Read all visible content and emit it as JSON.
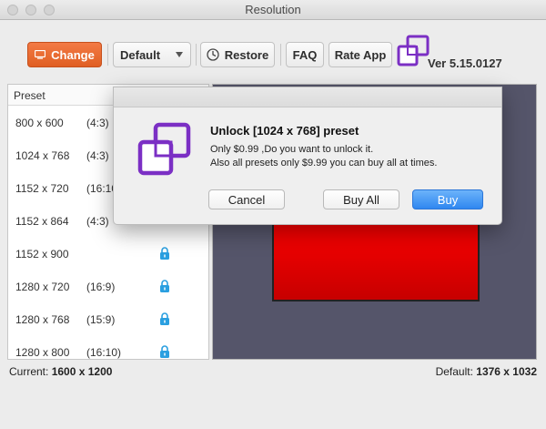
{
  "window": {
    "title": "Resolution"
  },
  "toolbar": {
    "change_label": "Change",
    "default_label": "Default",
    "restore_label": "Restore",
    "faq_label": "FAQ",
    "rate_label": "Rate App",
    "version": "Ver 5.15.0127"
  },
  "list": {
    "header": "Preset",
    "items": [
      {
        "res": "800 x 600",
        "ratio": "(4:3)",
        "locked": false
      },
      {
        "res": "1024 x 768",
        "ratio": "(4:3)",
        "locked": false
      },
      {
        "res": "1152 x 720",
        "ratio": "(16:10)",
        "locked": false
      },
      {
        "res": "1152 x 864",
        "ratio": "(4:3)",
        "locked": false
      },
      {
        "res": "1152 x 900",
        "ratio": "",
        "locked": true
      },
      {
        "res": "1280 x 720",
        "ratio": "(16:9)",
        "locked": true
      },
      {
        "res": "1280 x 768",
        "ratio": "(15:9)",
        "locked": true
      },
      {
        "res": "1280 x 800",
        "ratio": "(16:10)",
        "locked": true
      }
    ]
  },
  "footer": {
    "current_label": "Current:",
    "current_value": "1600 x 1200",
    "default_label": "Default:",
    "default_value": "1376 x 1032"
  },
  "dialog": {
    "title": "Unlock [1024 x 768] preset",
    "line1": "Only $0.99 ,Do you want to unlock it.",
    "line2": "Also all presets only $9.99 you can buy all at times.",
    "cancel": "Cancel",
    "buy_all": "Buy All",
    "buy": "Buy"
  },
  "colors": {
    "accent": "#e8662b",
    "primary": "#3a8ff2",
    "brand": "#7b2fc4",
    "preview_bg": "#55556a"
  }
}
